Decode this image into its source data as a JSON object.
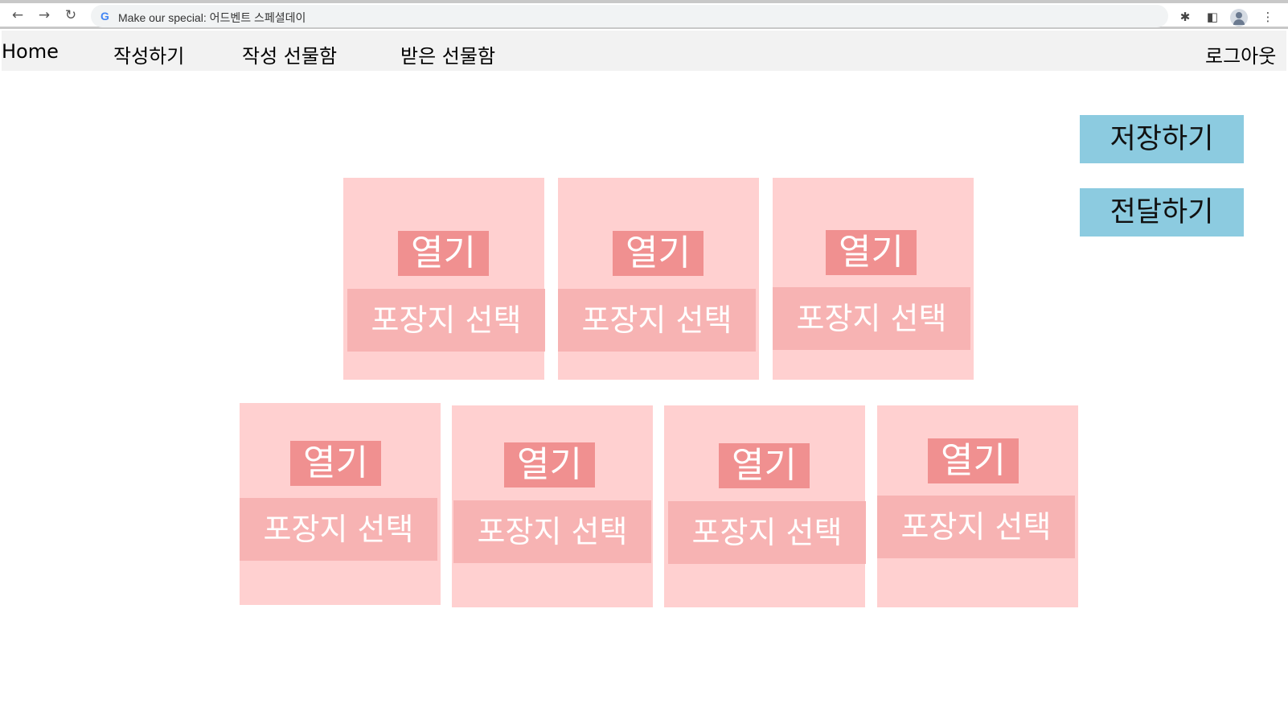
{
  "browser": {
    "back_icon": "back-arrow-icon",
    "forward_icon": "forward-arrow-icon",
    "reload_icon": "reload-icon",
    "address_text": "Make our special: 어드벤트 스페셜데이",
    "extensions_icon": "puzzle-icon",
    "sidepanel_icon": "side-panel-icon",
    "profile_icon": "profile-icon",
    "menu_icon": "kebab-menu-icon"
  },
  "nav": {
    "home": "Home",
    "write": "작성하기",
    "written_box": "작성 선물함",
    "received_box": "받은 선물함",
    "logout": "로그아웃"
  },
  "actions": {
    "save": "저장하기",
    "send": "전달하기"
  },
  "gifts": [
    {
      "open_label": "열기",
      "wrap_label": "포장지 선택"
    },
    {
      "open_label": "열기",
      "wrap_label": "포장지 선택"
    },
    {
      "open_label": "열기",
      "wrap_label": "포장지 선택"
    },
    {
      "open_label": "열기",
      "wrap_label": "포장지 선택"
    },
    {
      "open_label": "열기",
      "wrap_label": "포장지 선택"
    },
    {
      "open_label": "열기",
      "wrap_label": "포장지 선택"
    },
    {
      "open_label": "열기",
      "wrap_label": "포장지 선택"
    }
  ],
  "colors": {
    "box_background": "#ffd0d0",
    "open_button": "#f09090",
    "wrap_button": "#f7b3b3",
    "action_button": "#8ccbe0",
    "nav_background": "#f2f2f2"
  }
}
